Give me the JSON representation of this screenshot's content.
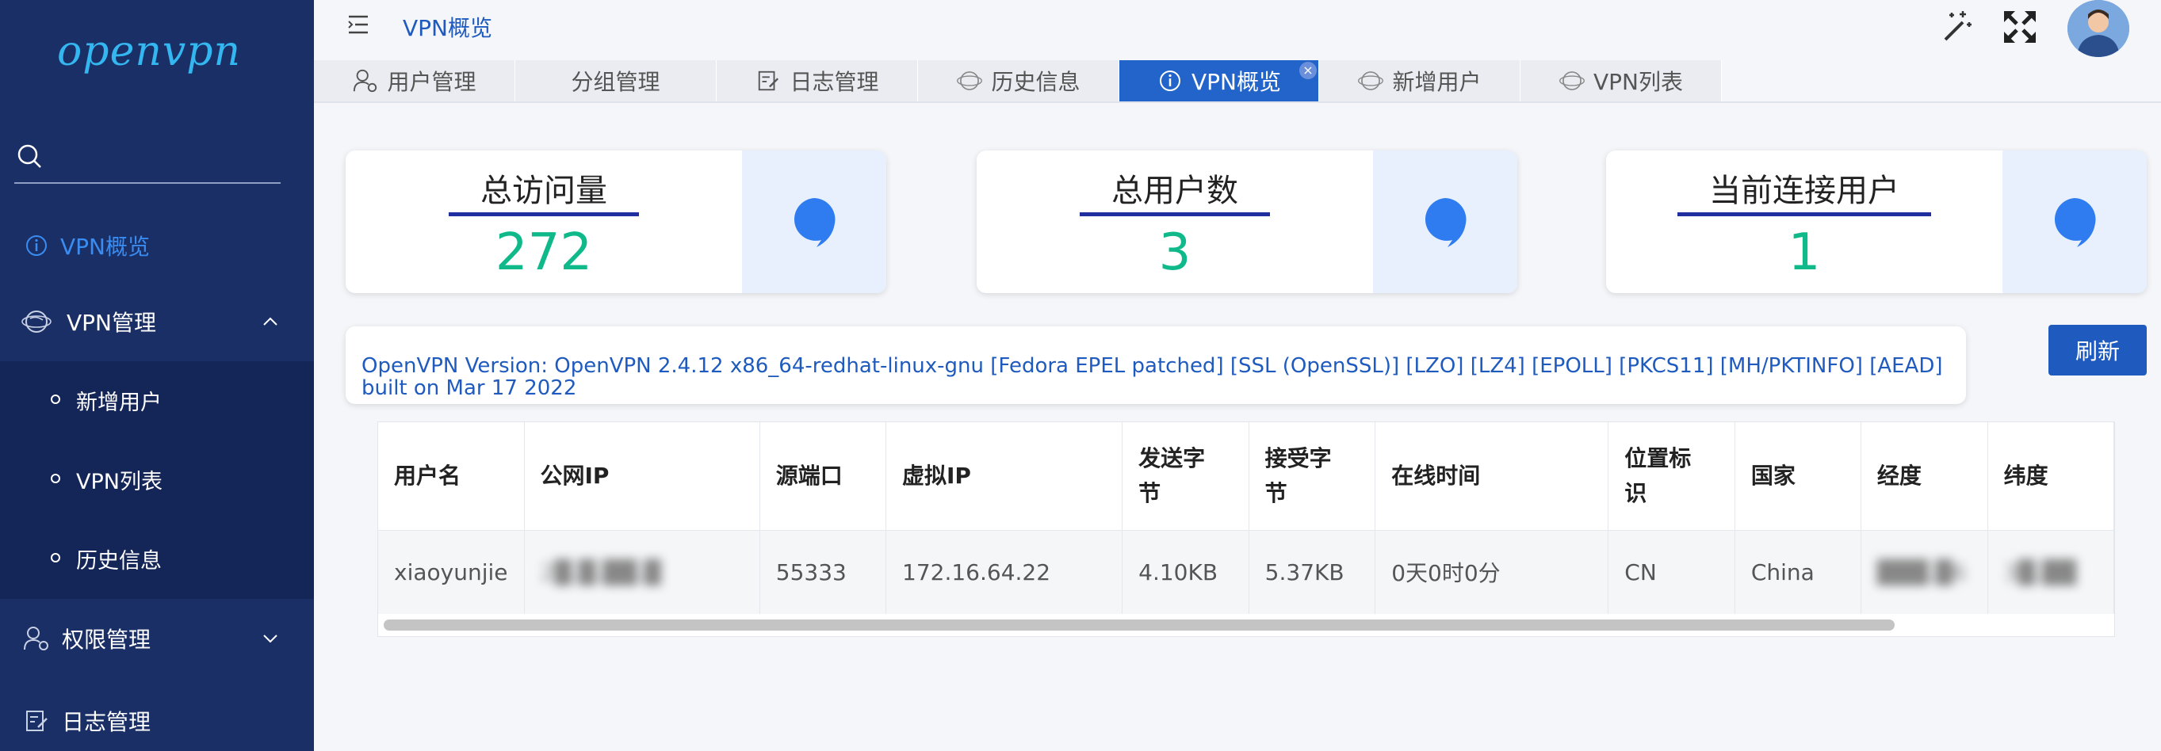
{
  "sidebar": {
    "logo": "openvpn",
    "search": {
      "placeholder": "",
      "value": ""
    },
    "items": [
      {
        "label": "VPN概览",
        "icon": "info-icon",
        "active": true
      },
      {
        "label": "VPN管理",
        "icon": "globe-icon",
        "expanded": true
      },
      {
        "label": "新增用户",
        "sub": true
      },
      {
        "label": "VPN列表",
        "sub": true
      },
      {
        "label": "历史信息",
        "sub": true
      },
      {
        "label": "权限管理",
        "icon": "user-gear-icon",
        "expanded": false
      },
      {
        "label": "日志管理",
        "icon": "edit-log-icon"
      }
    ]
  },
  "header": {
    "title": "VPN概览"
  },
  "tabs": [
    {
      "label": "用户管理",
      "icon": "user-gear-icon"
    },
    {
      "label": "分组管理",
      "icon": ""
    },
    {
      "label": "日志管理",
      "icon": "edit-log-icon"
    },
    {
      "label": "历史信息",
      "icon": "globe-icon"
    },
    {
      "label": "VPN概览",
      "icon": "info-icon",
      "active": true,
      "close": "×"
    },
    {
      "label": "新增用户",
      "icon": "globe-icon"
    },
    {
      "label": "VPN列表",
      "icon": "globe-icon"
    }
  ],
  "stats": [
    {
      "title": "总访问量",
      "value": "272"
    },
    {
      "title": "总用户数",
      "value": "3"
    },
    {
      "title": "当前连接用户",
      "value": "1"
    }
  ],
  "version": {
    "text": "OpenVPN Version: OpenVPN 2.4.12 x86_64-redhat-linux-gnu [Fedora EPEL patched] [SSL (OpenSSL)] [LZO] [LZ4] [EPOLL] [PKCS11] [MH/PKTINFO] [AEAD] built on Mar 17 2022"
  },
  "refresh_label": "刷新",
  "table": {
    "headers": [
      "用户名",
      "公网IP",
      "源端口",
      "虚拟IP",
      "发送字节",
      "接受字节",
      "在线时间",
      "位置标识",
      "国家",
      "经度",
      "纬度"
    ],
    "rows": [
      [
        "xiaoyunjie",
        "2█.█.██.█",
        "55333",
        "172.16.64.22",
        "4.10KB",
        "5.37KB",
        "0天0时0分",
        "CN",
        "China",
        "███.█6",
        "3█.██"
      ]
    ]
  },
  "colors": {
    "sidebar_bg": "#1a2f66",
    "accent": "#2264c9",
    "stat_value": "#0fb98a",
    "version_text": "#1f5bbf"
  }
}
